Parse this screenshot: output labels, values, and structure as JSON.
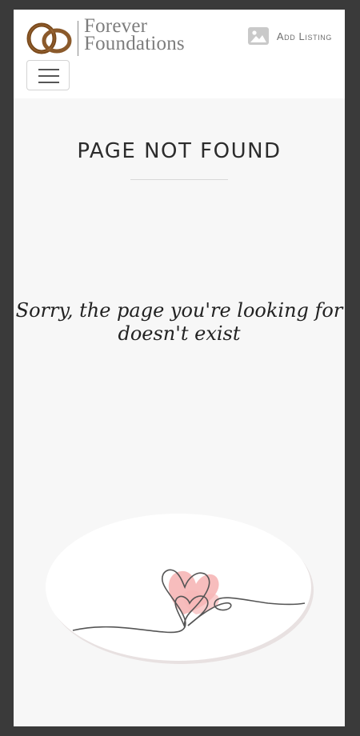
{
  "header": {
    "brand_line1": "Forever",
    "brand_line2": "Foundations",
    "add_listing_label": "Add Listing"
  },
  "main": {
    "title": "PAGE NOT FOUND",
    "message": "Sorry, the page you're looking for doesn't exist"
  },
  "icons": {
    "logo": "wedding-rings-icon",
    "add_listing": "image-icon",
    "menu": "hamburger-icon"
  },
  "colors": {
    "page_background": "#f7f7f7",
    "header_background": "#ffffff",
    "brand_text": "#7d7d7d",
    "ring_brown": "#7a4a1c",
    "heart_pink": "#f4a7a7"
  }
}
